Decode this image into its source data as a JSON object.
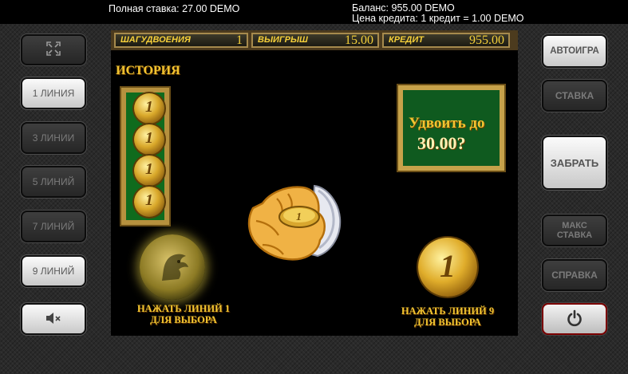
{
  "top": {
    "total_bet": "Полная ставка: 27.00 DEMO",
    "balance": "Баланс: 955.00 DEMO",
    "credit_price": "Цена кредита: 1 кредит = 1.00 DEMO"
  },
  "left_buttons": {
    "lines": [
      "1 ЛИНИЯ",
      "3 ЛИНИИ",
      "5 ЛИНИЙ",
      "7 ЛИНИЙ",
      "9 ЛИНИЙ"
    ],
    "fullscreen_icon": "fullscreen-icon",
    "sound_icon": "speaker-muted-icon"
  },
  "right_buttons": {
    "autoplay": "АВТОИГРА",
    "bet": "СТАВКА",
    "take": "ЗАБРАТЬ",
    "max_bet": "МАКС СТАВКА",
    "help": "СПРАВКА",
    "power_icon": "power-icon"
  },
  "game": {
    "double_step_label": "ШАГУДВОЕНИЯ",
    "double_step_value": "1",
    "win_label": "ВЫИГРЫШ",
    "win_value": "15.00",
    "credit_label": "КРЕДИТ",
    "credit_value": "955.00",
    "history_title": "ИСТОРИЯ",
    "history_coins": [
      "1",
      "1",
      "1",
      "1"
    ],
    "double_prompt": "Удвоить до",
    "double_amount": "30.00?",
    "left_caption_1": "НАЖАТЬ ЛИНИЙ 1",
    "left_caption_2": "ДЛЯ ВЫБОРА",
    "right_caption_1": "НАЖАТЬ ЛИНИЙ 9",
    "right_caption_2": "ДЛЯ ВЫБОРА",
    "coin_value": "1"
  },
  "colors": {
    "gold": "#f2c431",
    "green_panel": "#0f6b1d",
    "frame": "#b6913e"
  }
}
